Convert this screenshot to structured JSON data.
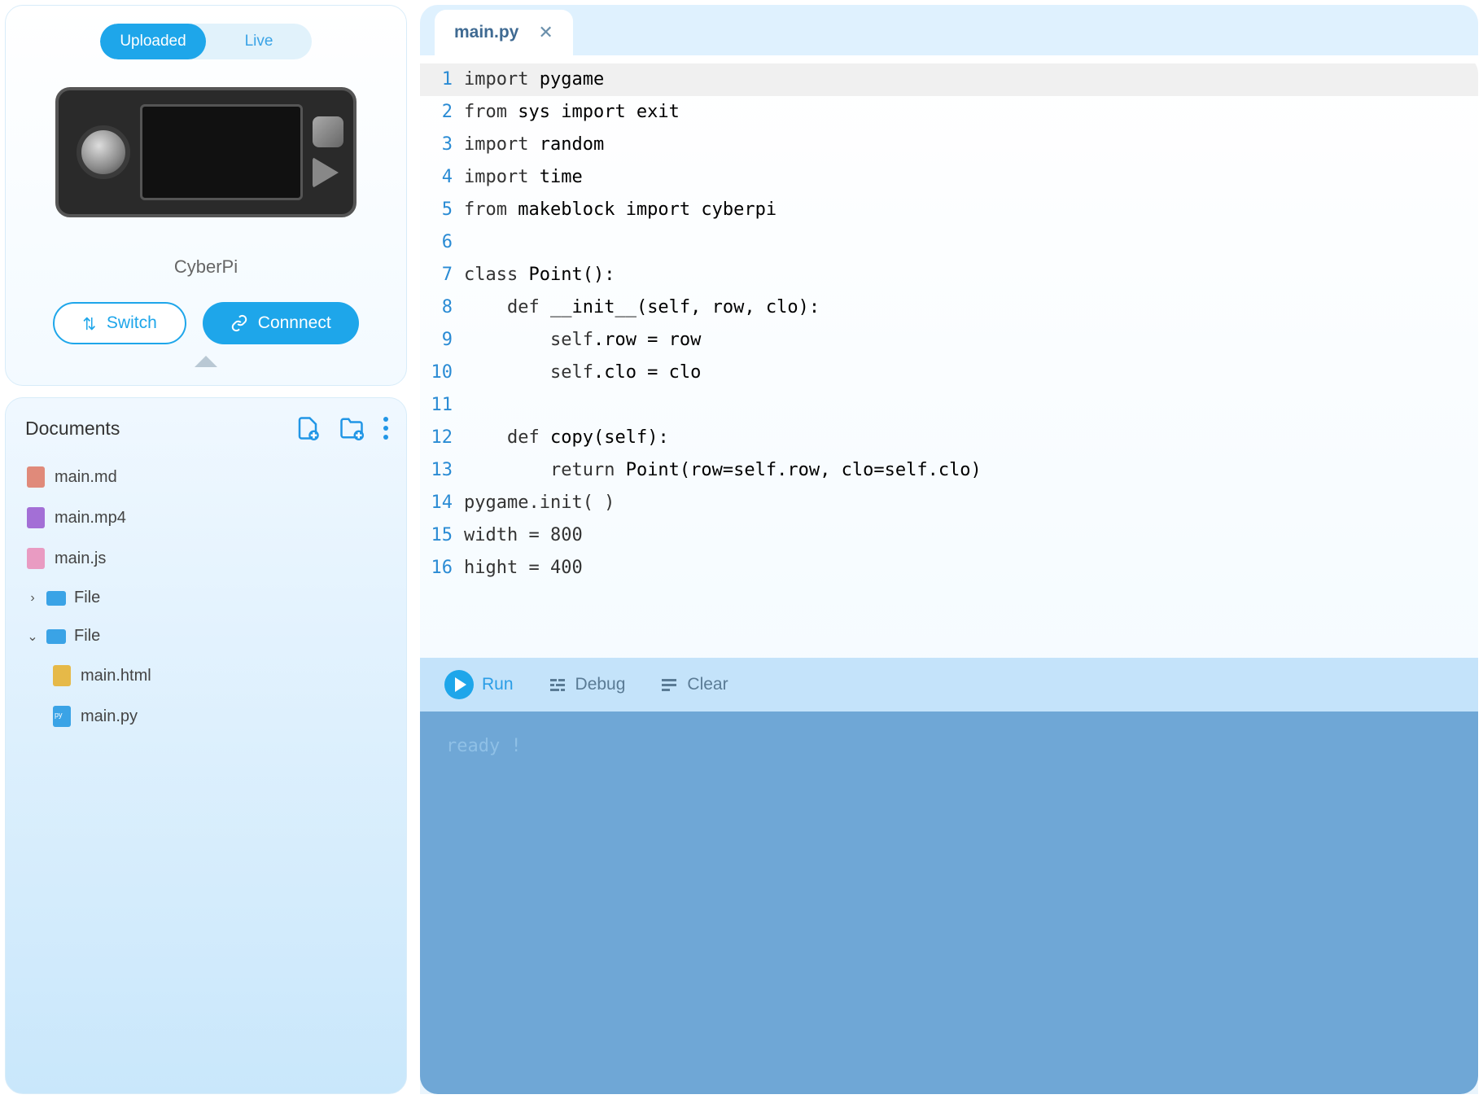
{
  "device": {
    "toggle": {
      "uploaded": "Uploaded",
      "live": "Live",
      "active": "uploaded"
    },
    "name": "CyberPi",
    "switch_label": "Switch",
    "connect_label": "Connnect"
  },
  "documents": {
    "title": "Documents",
    "items": [
      {
        "name": "main.md",
        "type": "md"
      },
      {
        "name": "main.mp4",
        "type": "mp4"
      },
      {
        "name": "main.js",
        "type": "js"
      }
    ],
    "folders": [
      {
        "name": "File",
        "expanded": false,
        "children": []
      },
      {
        "name": "File",
        "expanded": true,
        "children": [
          {
            "name": "main.html",
            "type": "html"
          },
          {
            "name": "main.py",
            "type": "py"
          }
        ]
      }
    ]
  },
  "editor": {
    "tab": {
      "title": "main.py"
    },
    "lines": [
      "import pygame",
      "from sys import exit",
      "import random",
      "import time",
      "from makeblock import cyberpi",
      "",
      "class Point():",
      "    def __init__(self, row, clo):",
      "        self.row = row",
      "        self.clo = clo",
      "",
      "    def copy(self):",
      "        return Point(row=self.row, clo=self.clo)",
      "pygame.init( )",
      "width = 800",
      "hight = 400"
    ],
    "active_line": 1
  },
  "actions": {
    "run": "Run",
    "debug": "Debug",
    "clear": "Clear"
  },
  "console": {
    "text": "ready !"
  }
}
